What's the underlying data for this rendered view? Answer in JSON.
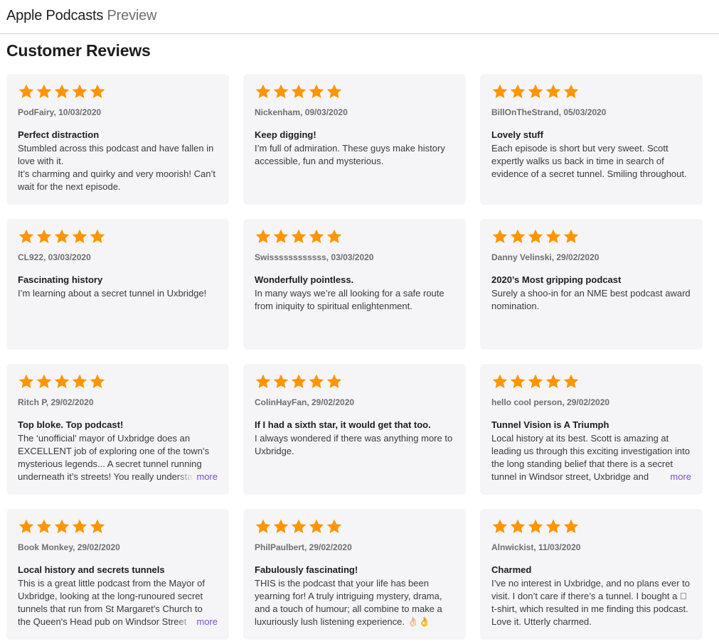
{
  "header": {
    "brand_name": "Apple Podcasts",
    "brand_suffix": "Preview"
  },
  "section_title": "Customer Reviews",
  "colors": {
    "star": "#ff9500",
    "more_link": "#7b4fcf",
    "card_bg": "#f5f5f7"
  },
  "reviews": [
    {
      "rating": 5,
      "meta": "PodFairy, 10/03/2020",
      "title": "Perfect distraction",
      "body": "Stumbled across this podcast and have fallen in love with it.\nIt’s charming and quirky and very moorish! Can’t wait for the next episode.",
      "more": ""
    },
    {
      "rating": 5,
      "meta": "Nickenham, 09/03/2020",
      "title": "Keep digging!",
      "body": "I’m full of admiration. These guys make history accessible, fun and mysterious.",
      "more": ""
    },
    {
      "rating": 5,
      "meta": "BillOnTheStrand, 05/03/2020",
      "title": "Lovely stuff",
      "body": "Each episode is short but very sweet. Scott expertly walks us back in time in search of evidence of a secret tunnel. Smiling throughout.",
      "more": ""
    },
    {
      "rating": 5,
      "meta": "CL922, 03/03/2020",
      "title": "Fascinating history",
      "body": "I’m learning about a secret tunnel in Uxbridge!",
      "more": ""
    },
    {
      "rating": 5,
      "meta": "Swissssssssssss, 03/03/2020",
      "title": "Wonderfully pointless.",
      "body": "In many ways we’re all looking for a safe route from iniquity to spiritual enlightenment.",
      "more": ""
    },
    {
      "rating": 5,
      "meta": "Danny Velinski, 29/02/2020",
      "title": "2020’s Most gripping podcast",
      "body": "Surely a shoo-in for an NME best podcast award nomination.",
      "more": ""
    },
    {
      "rating": 5,
      "meta": "Ritch P, 29/02/2020",
      "title": "Top bloke. Top podcast!",
      "body": "The ‘unofficial’ mayor of Uxbridge does an EXCELLENT job of exploring one of the town’s mysterious legends... A secret tunnel running underneath it’s streets! You really understand",
      "more": "more"
    },
    {
      "rating": 5,
      "meta": "ColinHayFan, 29/02/2020",
      "title": "If I had a sixth star, it would get that too.",
      "body": "I always wondered if there was anything more to Uxbridge.",
      "more": ""
    },
    {
      "rating": 5,
      "meta": "hello cool person, 29/02/2020",
      "title": "Tunnel Vision is A Triumph",
      "body": "Local history at its best. Scott is amazing at leading us through this exciting investigation into the long standing belief that there is a secret tunnel in Windsor street, Uxbridge and",
      "more": "more"
    },
    {
      "rating": 5,
      "meta": "Book Monkey, 29/02/2020",
      "title": "Local history and secrets tunnels",
      "body": "This is a great little podcast from the Mayor of Uxbridge, looking at the long-runoured secret tunnels that run from St Margaret's Church to the Queen's Head pub on Windsor Street",
      "more": "more"
    },
    {
      "rating": 5,
      "meta": "PhilPaulbert, 29/02/2020",
      "title": "Fabulously fascinating!",
      "body": "THIS is the podcast that your life has been yearning for! A truly intriguing mystery, drama, and a touch of humour; all combine to make a luxuriously lush listening experience. 👌🏻👌",
      "more": ""
    },
    {
      "rating": 5,
      "meta": "Alnwickist, 11/03/2020",
      "title": "Charmed",
      "body": "I’ve no interest in Uxbridge, and no plans ever to visit. I don’t care if there’s a tunnel. I bought a 🏻 t-shirt, which resulted in me finding this podcast. Love it. Utterly charmed.",
      "more": ""
    }
  ]
}
